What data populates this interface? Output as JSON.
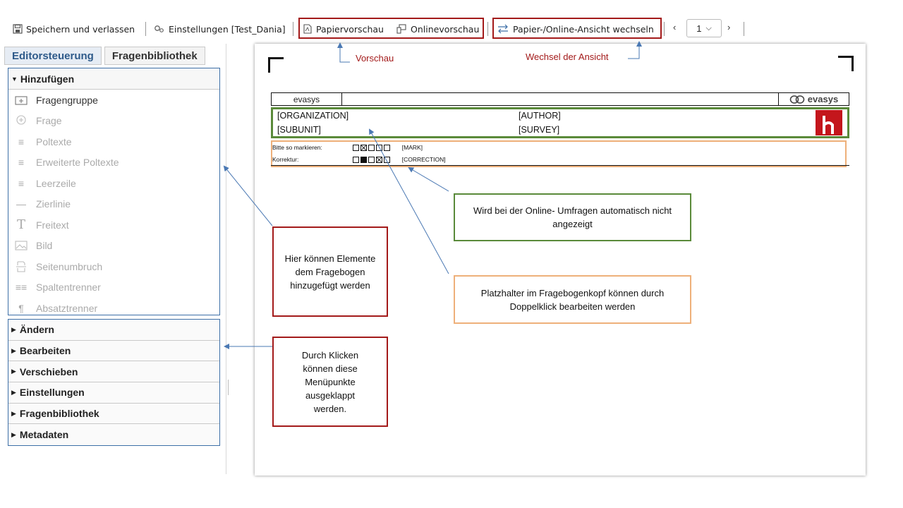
{
  "toolbar": {
    "save_label": "Speichern und verlassen",
    "settings_label": "Einstellungen [Test_Dania]",
    "paper_preview_label": "Papiervorschau",
    "online_preview_label": "Onlinevorschau",
    "switch_view_label": "Papier-/Online-Ansicht wechseln",
    "page_number": "1"
  },
  "sidebar": {
    "tabs": [
      "Editorsteuerung",
      "Fragenbibliothek"
    ],
    "add_panel_title": "Hinzufügen",
    "tools": [
      {
        "label": "Fragengruppe",
        "icon": "add-group-icon"
      },
      {
        "label": "Frage",
        "icon": "add-question-icon"
      },
      {
        "label": "Poltexte",
        "icon": "poltexte-icon"
      },
      {
        "label": "Erweiterte Poltexte",
        "icon": "extended-poltexte-icon"
      },
      {
        "label": "Leerzeile",
        "icon": "empty-line-icon"
      },
      {
        "label": "Zierlinie",
        "icon": "decorative-line-icon"
      },
      {
        "label": "Freitext",
        "icon": "freetext-icon"
      },
      {
        "label": "Bild",
        "icon": "image-icon"
      },
      {
        "label": "Seitenumbruch",
        "icon": "page-break-icon"
      },
      {
        "label": "Spaltentrenner",
        "icon": "column-separator-icon"
      },
      {
        "label": "Absatztrenner",
        "icon": "paragraph-separator-icon"
      }
    ],
    "collapsed_sections": [
      "Ändern",
      "Bearbeiten",
      "Verschieben",
      "Einstellungen",
      "Fragenbibliothek",
      "Metadaten"
    ]
  },
  "document": {
    "brand_left": "evasys",
    "brand_right": "evasys",
    "organization": "[ORGANIZATION]",
    "author": "[AUTHOR]",
    "subunit": "[SUBUNIT]",
    "survey": "[SURVEY]",
    "mark_label": "Bitte so markieren:",
    "mark_placeholder": "[MARK]",
    "correction_label": "Korrektur:",
    "correction_placeholder": "[CORRECTION]"
  },
  "annotations": {
    "preview_label": "Vorschau",
    "switch_label": "Wechsel der Ansicht",
    "add_note": "Hier können Elemente dem Fragebogen hinzugefügt werden",
    "expand_note": "Durch Klicken können diese Menüpunkte ausgeklappt werden.",
    "online_note": "Wird bei der Online- Umfragen automatisch nicht angezeigt",
    "placeholder_note": "Platzhalter im Fragebogenkopf können durch Doppelklick bearbeiten werden"
  },
  "colors": {
    "annotation_red": "#a31a1a",
    "annotation_green": "#5a8a3a",
    "annotation_orange": "#eeb07a",
    "panel_blue": "#3d6fa7"
  }
}
